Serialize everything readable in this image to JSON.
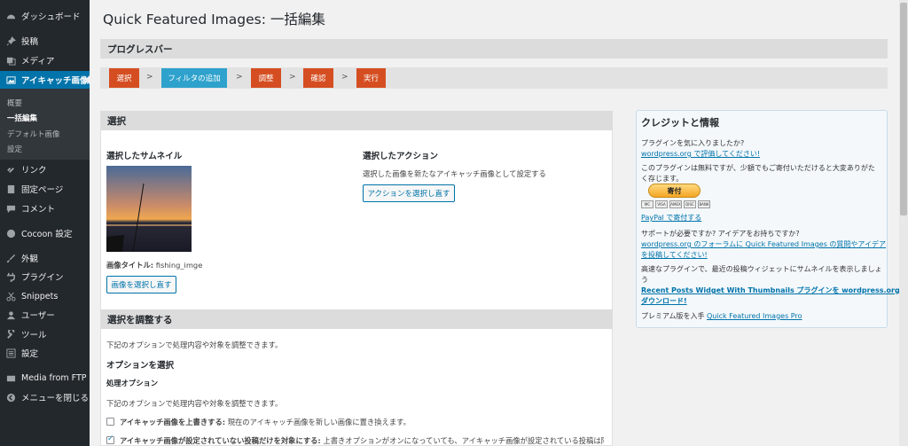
{
  "sidebar": {
    "items": [
      {
        "label": "ダッシュボード",
        "icon": "dashboard-icon"
      },
      {
        "label": "投稿",
        "icon": "pin-icon"
      },
      {
        "label": "メディア",
        "icon": "media-icon"
      },
      {
        "label": "アイキャッチ画像",
        "icon": "image-icon"
      },
      {
        "label": "リンク",
        "icon": "link-icon"
      },
      {
        "label": "固定ページ",
        "icon": "page-icon"
      },
      {
        "label": "コメント",
        "icon": "comment-icon"
      },
      {
        "label": "Cocoon 設定",
        "icon": "cocoon-icon"
      },
      {
        "label": "外観",
        "icon": "brush-icon"
      },
      {
        "label": "プラグイン",
        "icon": "plugin-icon"
      },
      {
        "label": "Snippets",
        "icon": "scissors-icon"
      },
      {
        "label": "ユーザー",
        "icon": "user-icon"
      },
      {
        "label": "ツール",
        "icon": "wrench-icon"
      },
      {
        "label": "設定",
        "icon": "settings-icon"
      },
      {
        "label": "Media from FTP",
        "icon": "upload-icon"
      },
      {
        "label": "メニューを閉じる",
        "icon": "collapse-icon"
      }
    ],
    "submenu": [
      "概要",
      "一括編集",
      "デフォルト画像",
      "設定"
    ]
  },
  "page_title": "Quick Featured Images: 一括編集",
  "progress": {
    "heading": "プログレスバー",
    "steps": [
      "選択",
      "フィルタの追加",
      "調整",
      "確認",
      "実行"
    ],
    "arrow": ">"
  },
  "select": {
    "heading": "選択",
    "thumb_heading": "選択したサムネイル",
    "image_title_label": "画像タイトル:",
    "image_title_value": "fishing_imge",
    "reselect_image_button": "画像を選択し直す",
    "action_heading": "選択したアクション",
    "action_desc": "選択した画像を新たなアイキャッチ画像として設定する",
    "reselect_action_button": "アクションを選択し直す"
  },
  "adjust": {
    "heading": "選択を調整する",
    "desc": "下記のオプションで処理内容や対象を調整できます。",
    "options_heading": "オプションを選択",
    "processing_heading": "処理オプション",
    "processing_desc": "下記のオプションで処理内容や対象を調整できます。",
    "opt1_label": "アイキャッチ画像を上書きする:",
    "opt1_desc": "現在のアイキャッチ画像を新しい画像に置き換えます。",
    "opt2_label": "アイキャッチ画像が設定されていない投稿だけを対象にする:",
    "opt2_desc": "上書きオプションがオンになっていても、アイキャッチ画像が設定されている投稿は除"
  },
  "credits": {
    "title": "クレジットと情報",
    "like_q": "プラグインを気に入りましたか?",
    "rate_link": "wordpress.org で評価してください!",
    "free_text_1": "このプラグインは無料ですが、少額でもご寄付いただけると大変ありがた",
    "free_text_2": "く存じます。",
    "donate_button": "寄付",
    "paypal_link": "PayPal で寄付する",
    "support_q": "サポートが必要ですか? アイデアをお持ちですか?",
    "forum_link_1": "wordpress.org のフォーラムに Quick Featured Images の質問やアイデア",
    "forum_link_2": "を投稿してください!",
    "widget_text_1": "高速なプラグインで、最近の投稿ウィジェットにサムネイルを表示しましょ",
    "widget_text_2": "う",
    "widget_link_1": "Recent Posts Widget With Thumbnails プラグインを wordpress.org から",
    "widget_link_2": "ダウンロード!",
    "premium_text": "プレミアム版を入手",
    "premium_link": "Quick Featured Images Pro",
    "cards": [
      "MC",
      "VISA",
      "AMEX",
      "DISC",
      "BANK"
    ]
  },
  "colors": {
    "sidebar_bg": "#23282d",
    "accent": "#0073aa",
    "step_orange": "#d54e21",
    "step_active": "#2ea2cc"
  }
}
